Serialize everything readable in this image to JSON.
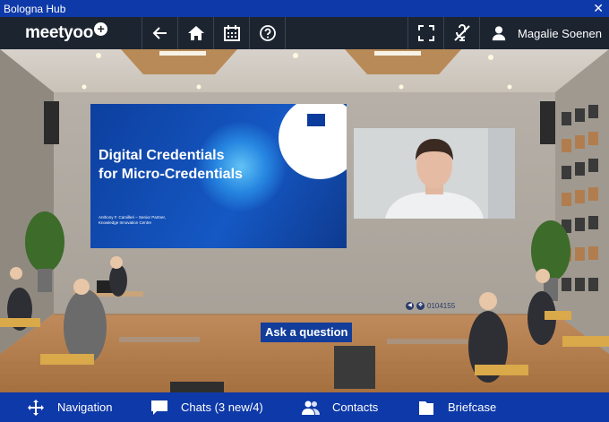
{
  "window": {
    "title": "Bologna Hub",
    "close_glyph": "✕"
  },
  "topnav": {
    "logo": "meetyoo",
    "logo_plus": "+",
    "buttons": [
      "back-arrow-icon",
      "home-icon",
      "calendar-icon",
      "help-icon"
    ],
    "right_buttons": [
      "fullscreen-icon",
      "mute-mic-icon"
    ],
    "user_name": "Magalie Soenen"
  },
  "slide": {
    "title_line1": "Digital Credentials",
    "title_line2": "for Micro-Credentials",
    "speaker_line1": "Anthony F. Camilleri – Senior Partner,",
    "speaker_line2": "Knowledge Innovation Centre"
  },
  "video_controls": {
    "timecode": "0104155"
  },
  "ask_button": "Ask a question",
  "bottomnav": {
    "items": [
      {
        "label": "Navigation",
        "icon": "move-arrows-icon"
      },
      {
        "label": "Chats (3 new/4)",
        "icon": "chat-bubble-icon"
      },
      {
        "label": "Contacts",
        "icon": "contacts-icon"
      },
      {
        "label": "Briefcase",
        "icon": "briefcase-icon"
      }
    ]
  },
  "colors": {
    "brand_blue": "#0e39a8",
    "nav_dark": "#1c2430"
  }
}
